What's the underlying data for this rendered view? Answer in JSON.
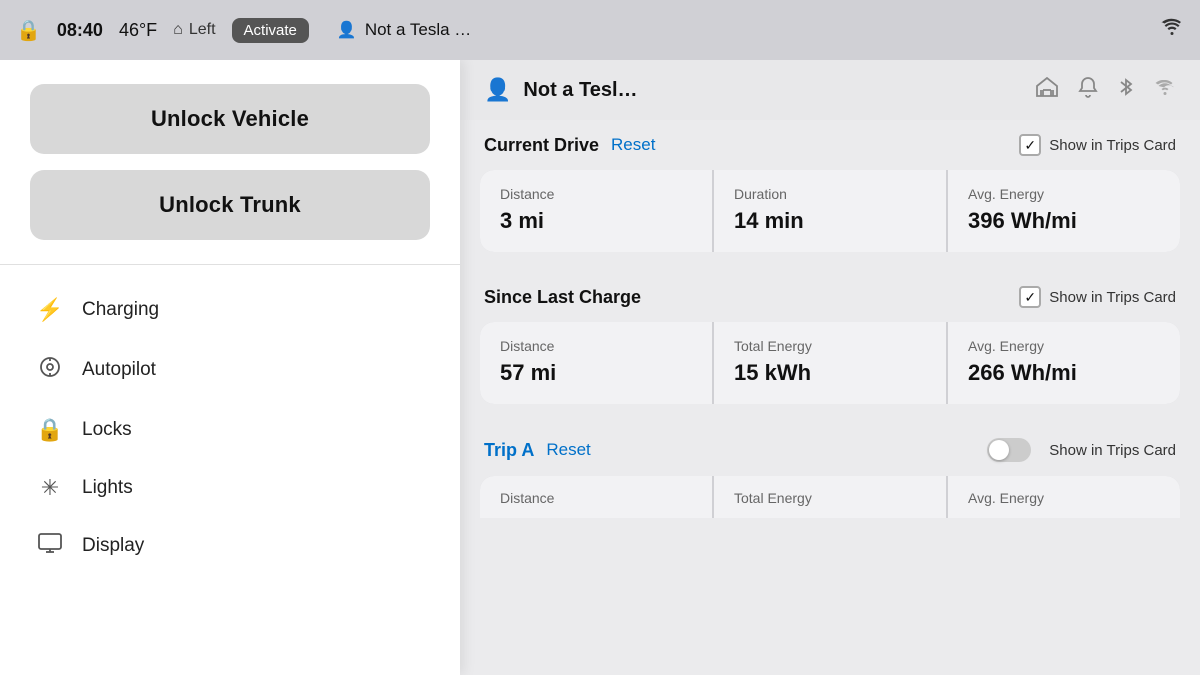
{
  "statusBar": {
    "lockIcon": "🔒",
    "time": "08:40",
    "temp": "46°F",
    "homeIcon": "⌂",
    "homeLabel": "Left",
    "activateBtn": "Activate",
    "accountIcon": "👤",
    "notTesla": "Not a Tesla …",
    "wifiIcon": "wifi"
  },
  "leftPanel": {
    "unlockVehicle": "Unlock Vehicle",
    "unlockTrunk": "Unlock Trunk",
    "navItems": [
      {
        "icon": "⚡",
        "label": "Charging"
      },
      {
        "icon": "🎛",
        "label": "Autopilot"
      },
      {
        "icon": "🔒",
        "label": "Locks"
      },
      {
        "icon": "✳",
        "label": "Lights"
      },
      {
        "icon": "🖥",
        "label": "Display"
      }
    ]
  },
  "rightPanel": {
    "header": {
      "userIcon": "👤",
      "title": "Not a Tesl…",
      "garageIcon": "⌂",
      "bellIcon": "🔔",
      "bluetoothIcon": "⚡",
      "wifiIcon": "wifi"
    },
    "sections": {
      "currentDrive": {
        "title": "Current Drive",
        "resetLabel": "Reset",
        "showInTripsCard": "Show in Trips Card",
        "checked": true,
        "stats": [
          {
            "label": "Distance",
            "value": "3 mi"
          },
          {
            "label": "Duration",
            "value": "14 min"
          },
          {
            "label": "Avg. Energy",
            "value": "396 Wh/mi"
          }
        ]
      },
      "sinceLastCharge": {
        "title": "Since Last Charge",
        "showInTripsCard": "Show in Trips Card",
        "checked": true,
        "stats": [
          {
            "label": "Distance",
            "value": "57 mi"
          },
          {
            "label": "Total Energy",
            "value": "15 kWh"
          },
          {
            "label": "Avg. Energy",
            "value": "266 Wh/mi"
          }
        ]
      },
      "tripA": {
        "title": "Trip A",
        "resetLabel": "Reset",
        "showInTripsCard": "Show in Trips Card",
        "checked": false,
        "partialStats": [
          {
            "label": "Distance"
          },
          {
            "label": "Total Energy"
          },
          {
            "label": "Avg. Energy"
          }
        ]
      }
    }
  }
}
